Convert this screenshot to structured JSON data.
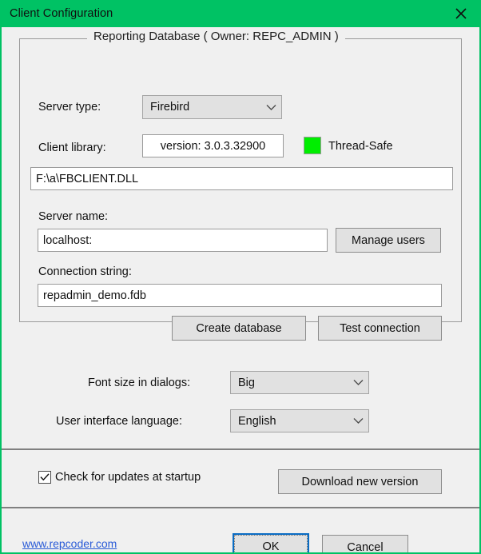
{
  "window": {
    "title": "Client Configuration",
    "close_icon": "close-icon",
    "titlebar_color": "#00c264"
  },
  "group": {
    "title": "Reporting Database ( Owner: REPC_ADMIN )"
  },
  "form": {
    "server_type_label": "Server type:",
    "server_type_value": "Firebird",
    "client_library_label": "Client library:",
    "client_library_version": "version: 3.0.3.32900",
    "thread_safe_label": "Thread-Safe",
    "thread_safe_color": "#00ee00",
    "client_library_path": "F:\\a\\FBCLIENT.DLL",
    "server_name_label": "Server name:",
    "server_name_value": "localhost:",
    "manage_users_label": "Manage users",
    "connection_string_label": "Connection string:",
    "connection_string_value": "repadmin_demo.fdb",
    "create_database_label": "Create database",
    "test_connection_label": "Test connection"
  },
  "preferences": {
    "font_size_label": "Font size in dialogs:",
    "font_size_value": "Big",
    "language_label": "User interface language:",
    "language_value": "English"
  },
  "updates": {
    "check_updates_label": "Check for updates at startup",
    "check_updates_checked": true,
    "download_label": "Download new version"
  },
  "footer": {
    "link_text": "www.repcoder.com",
    "ok_label": "OK",
    "cancel_label": "Cancel"
  }
}
